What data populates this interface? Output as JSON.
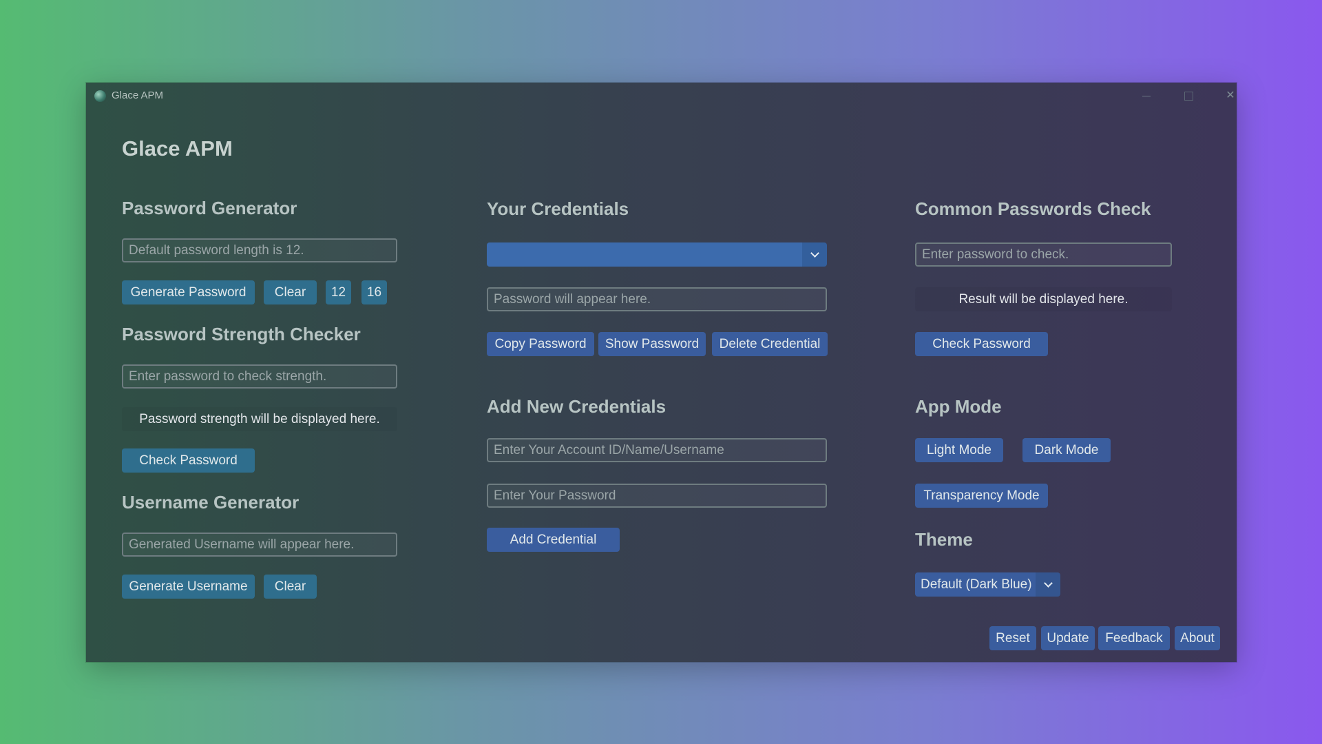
{
  "window": {
    "title": "Glace APM"
  },
  "app_title": "Glace APM",
  "password_generator": {
    "title": "Password Generator",
    "input_placeholder": "Default password length is 12.",
    "generate_label": "Generate Password",
    "clear_label": "Clear",
    "length_12_label": "12",
    "length_16_label": "16"
  },
  "strength_checker": {
    "title": "Password Strength Checker",
    "input_placeholder": "Enter password to check strength.",
    "result_text": "Password strength will be displayed here.",
    "check_label": "Check Password"
  },
  "username_generator": {
    "title": "Username Generator",
    "input_placeholder": "Generated Username will appear here.",
    "generate_label": "Generate Username",
    "clear_label": "Clear"
  },
  "credentials": {
    "title": "Your Credentials",
    "selected": "",
    "password_placeholder": "Password will appear here.",
    "copy_label": "Copy Password",
    "show_label": "Show Password",
    "delete_label": "Delete Credential"
  },
  "add_credentials": {
    "title": "Add New Credentials",
    "account_placeholder": "Enter Your Account ID/Name/Username",
    "password_placeholder": "Enter Your Password",
    "add_label": "Add Credential"
  },
  "common_check": {
    "title": "Common Passwords Check",
    "input_placeholder": "Enter password to check.",
    "result_text": "Result will be displayed here.",
    "check_label": "Check Password"
  },
  "app_mode": {
    "title": "App Mode",
    "light_label": "Light Mode",
    "dark_label": "Dark Mode",
    "transparency_label": "Transparency Mode"
  },
  "theme": {
    "title": "Theme",
    "selected": "Default (Dark Blue)"
  },
  "footer": {
    "reset_label": "Reset",
    "update_label": "Update",
    "feedback_label": "Feedback",
    "about_label": "About"
  },
  "colors": {
    "button_teal": "#2f6e8d",
    "button_blue": "#3a5d9e",
    "combo_blue": "#3c6bad"
  }
}
